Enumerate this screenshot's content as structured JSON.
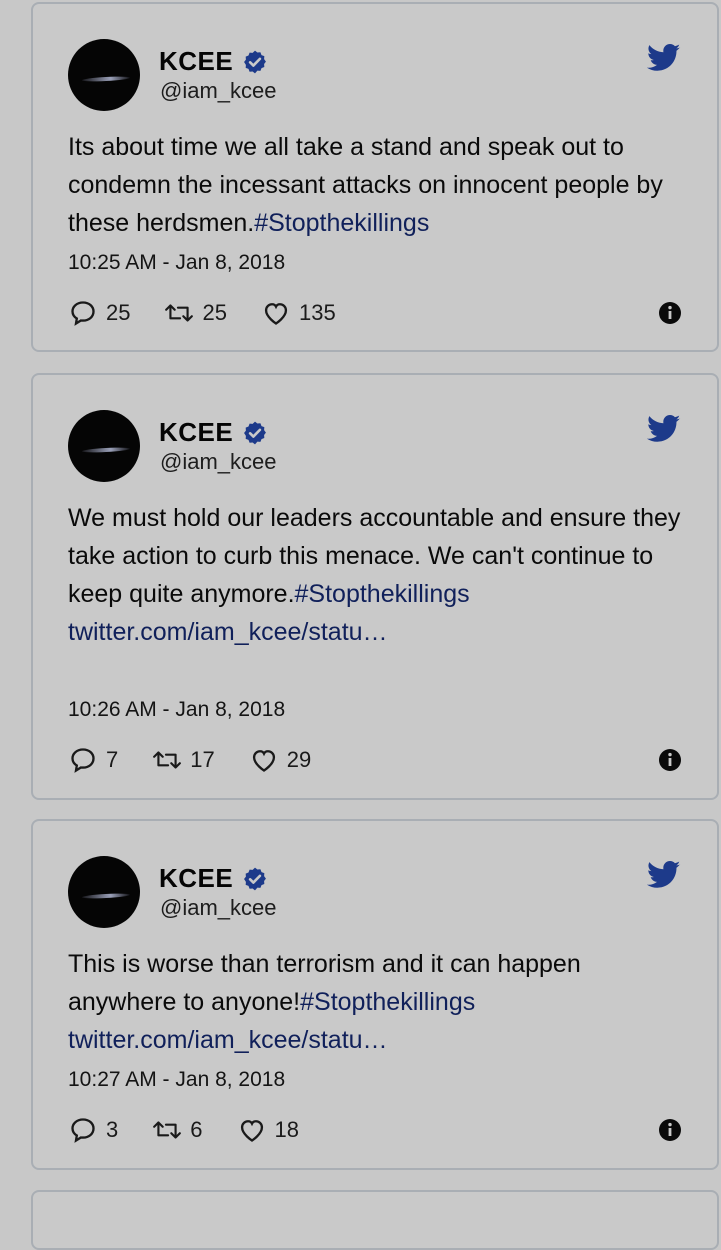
{
  "colors": {
    "background": "#c8c8c8",
    "card_border": "#a9aeb4",
    "accent_blue": "#1d3a8a",
    "hashtag": "#10205a"
  },
  "tweets": [
    {
      "name": "KCEE",
      "handle": "@iam_kcee",
      "text_plain": "Its about time we all take a stand and speak out to condemn the incessant attacks on innocent people by these herdsmen.",
      "hashtag": "#Stopthekillings",
      "link": "",
      "timestamp": "10:25 AM - Jan 8, 2018",
      "replies": "25",
      "retweets": "25",
      "likes": "135",
      "icons": [
        "reply-icon",
        "retweet-icon",
        "like-icon",
        "info-icon",
        "twitter-bird-icon",
        "verified-badge-icon"
      ]
    },
    {
      "name": "KCEE",
      "handle": "@iam_kcee",
      "text_plain": "We must hold our leaders accountable and ensure they take action to curb this menace. We can't continue to keep quite anymore.",
      "hashtag": "#Stopthekillings",
      "link": "twitter.com/iam_kcee/statu…",
      "timestamp": "10:26 AM - Jan 8, 2018",
      "replies": "7",
      "retweets": "17",
      "likes": "29",
      "icons": [
        "reply-icon",
        "retweet-icon",
        "like-icon",
        "info-icon",
        "twitter-bird-icon",
        "verified-badge-icon"
      ]
    },
    {
      "name": "KCEE",
      "handle": "@iam_kcee",
      "text_plain": "This is worse than terrorism and it can happen anywhere to anyone!",
      "hashtag": "#Stopthekillings",
      "link": "twitter.com/iam_kcee/statu…",
      "timestamp": "10:27 AM - Jan 8, 2018",
      "replies": "3",
      "retweets": "6",
      "likes": "18",
      "icons": [
        "reply-icon",
        "retweet-icon",
        "like-icon",
        "info-icon",
        "twitter-bird-icon",
        "verified-badge-icon"
      ]
    }
  ]
}
